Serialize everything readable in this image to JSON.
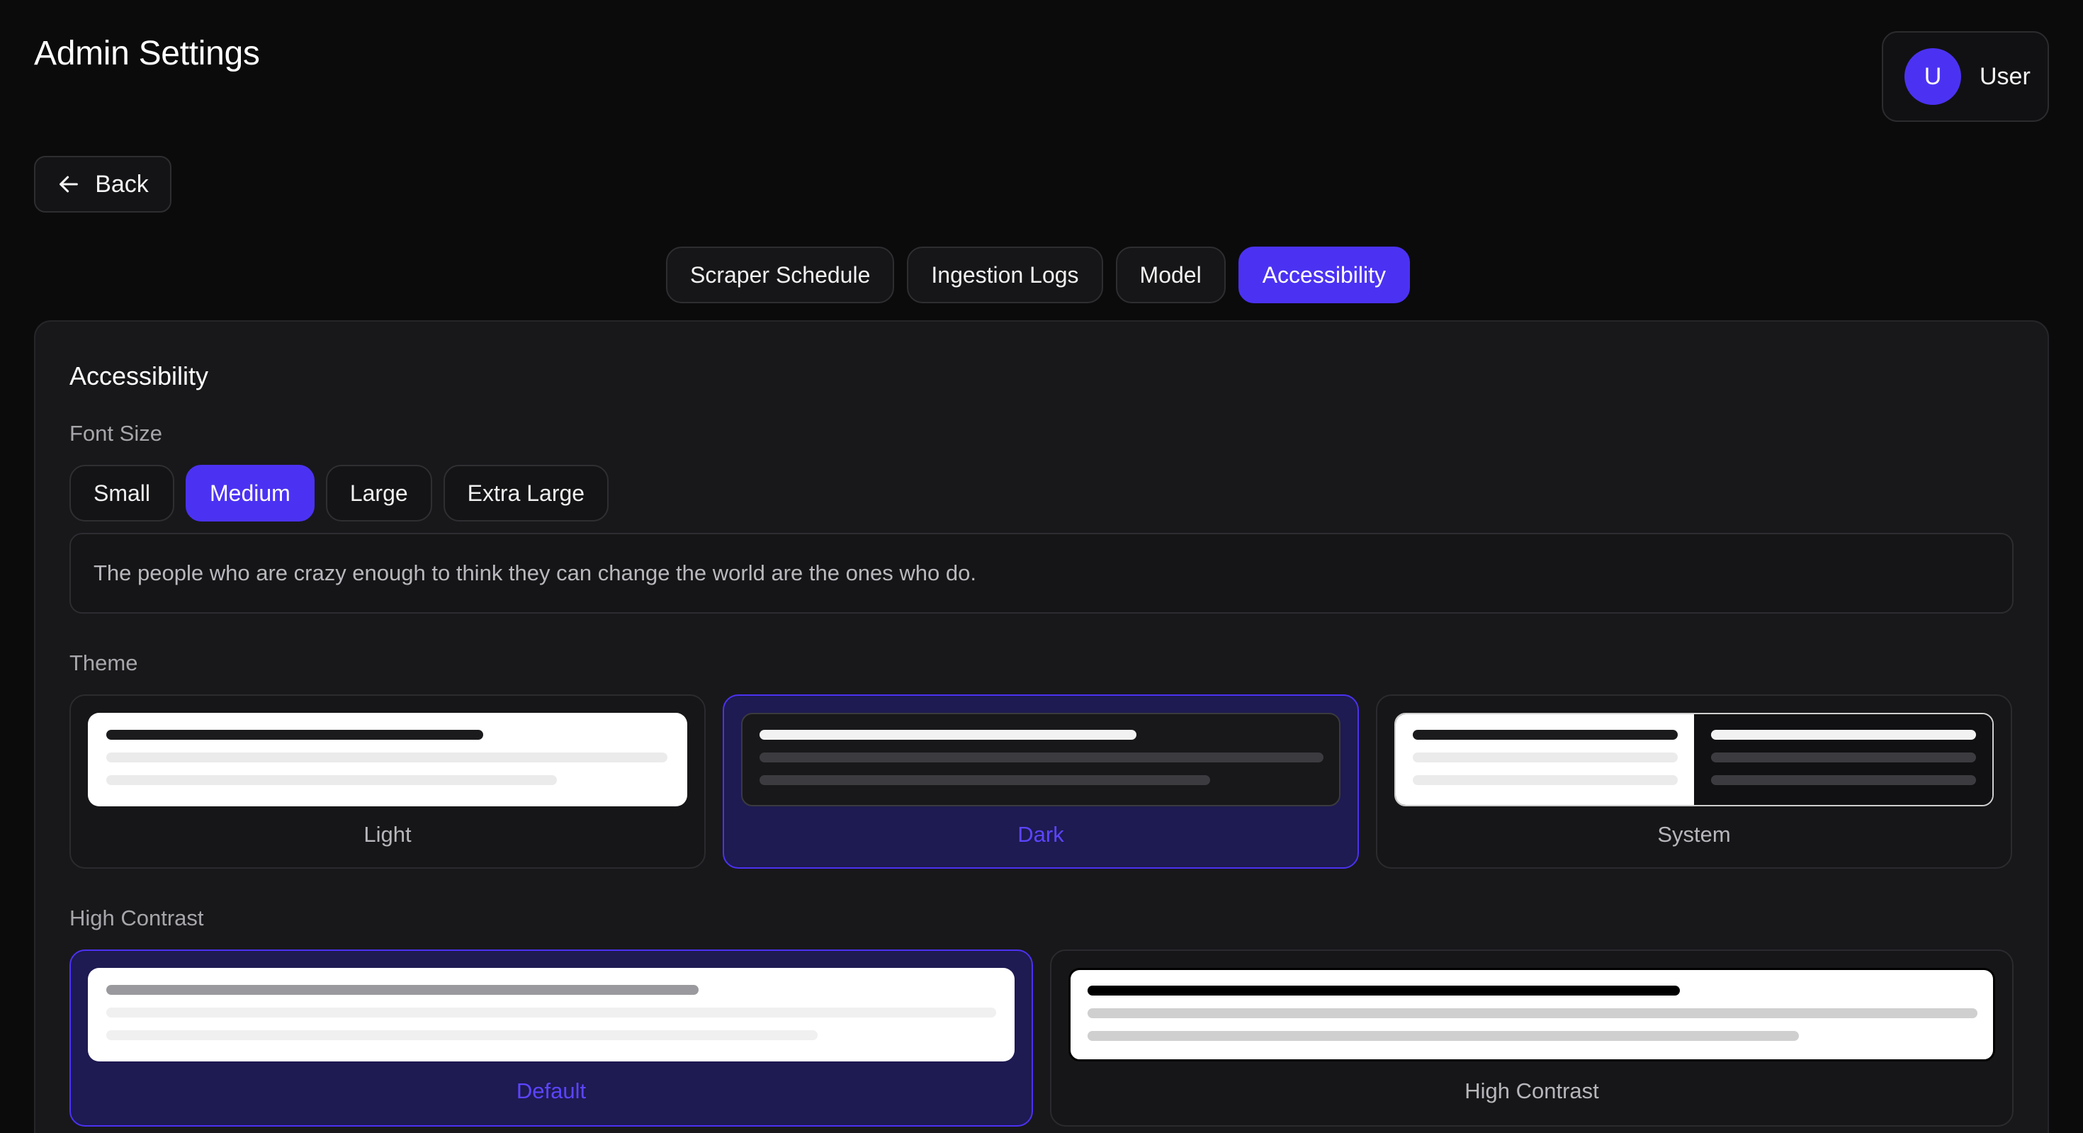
{
  "header": {
    "title": "Admin Settings",
    "user": {
      "initial": "U",
      "name": "User",
      "avatar_color": "#4b32f2"
    }
  },
  "back": {
    "label": "Back",
    "icon": "arrow-left-icon"
  },
  "tabs": [
    {
      "label": "Scraper Schedule",
      "active": false
    },
    {
      "label": "Ingestion Logs",
      "active": false
    },
    {
      "label": "Model",
      "active": false
    },
    {
      "label": "Accessibility",
      "active": true
    }
  ],
  "accessibility": {
    "title": "Accessibility",
    "font_size": {
      "label": "Font Size",
      "options": [
        {
          "label": "Small",
          "selected": false
        },
        {
          "label": "Medium",
          "selected": true
        },
        {
          "label": "Large",
          "selected": false
        },
        {
          "label": "Extra Large",
          "selected": false
        }
      ],
      "preview_text": "The people who are crazy enough to think they can change the world are the ones who do."
    },
    "theme": {
      "label": "Theme",
      "options": [
        {
          "label": "Light",
          "selected": false
        },
        {
          "label": "Dark",
          "selected": true
        },
        {
          "label": "System",
          "selected": false
        }
      ]
    },
    "high_contrast": {
      "label": "High Contrast",
      "options": [
        {
          "label": "Default",
          "selected": true
        },
        {
          "label": "High Contrast",
          "selected": false
        }
      ]
    }
  },
  "colors": {
    "accent": "#4b32f2",
    "background": "#0b0b0c",
    "panel": "#18181a",
    "selected_card": "#1e1a52"
  }
}
